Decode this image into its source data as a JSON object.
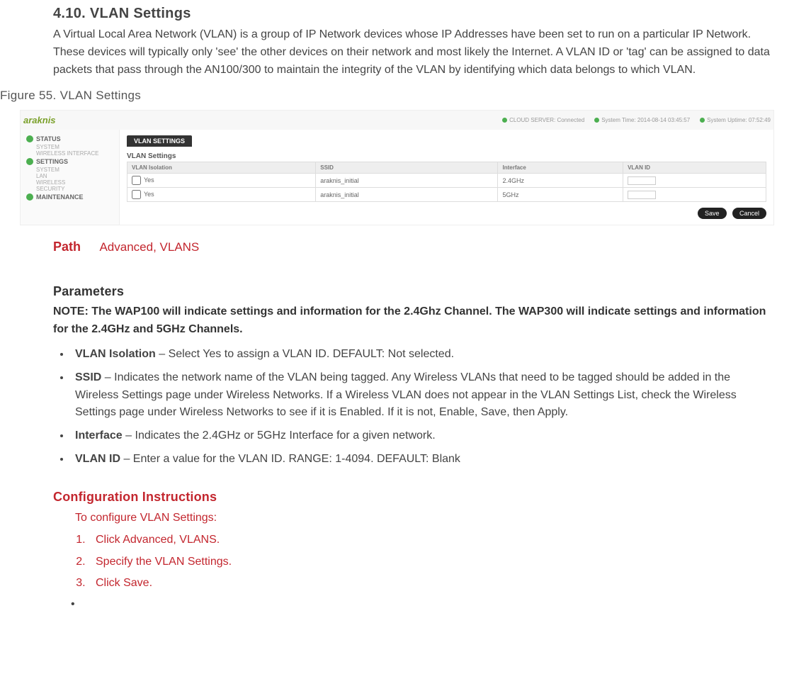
{
  "sectionTitle": "4.10. VLAN Settings",
  "intro": "A Virtual Local Area Network (VLAN) is a group of IP Network devices whose IP Addresses have been set to run on a particular IP Network. These devices will typically only 'see' the other devices on their network and most likely the Internet. A VLAN ID or 'tag' can be assigned to data packets that pass through the AN100/300 to maintain the integrity of the VLAN by identifying which data belongs to which VLAN.",
  "figureCaption": "Figure 55. VLAN Settings",
  "screenshot": {
    "logo": "araknis",
    "cloud": "CLOUD SERVER:  Connected",
    "systemTime": "System Time:  2014-08-14 03:45:57",
    "uptime": "System Uptime:  07:52:49",
    "sidebar": {
      "items": [
        {
          "label": "STATUS",
          "subs": [
            "SYSTEM",
            "WIRELESS INTERFACE"
          ]
        },
        {
          "label": "SETTINGS",
          "subs": [
            "SYSTEM",
            "LAN",
            "WIRELESS",
            "SECURITY"
          ]
        },
        {
          "label": "MAINTENANCE",
          "subs": []
        }
      ]
    },
    "tab": "VLAN SETTINGS",
    "panelTitle": "VLAN Settings",
    "tableHeaders": [
      "VLAN Isolation",
      "SSID",
      "Interface",
      "VLAN ID"
    ],
    "rows": [
      {
        "iso": "Yes",
        "ssid": "araknis_initial",
        "iface": "2.4GHz"
      },
      {
        "iso": "Yes",
        "ssid": "araknis_initial",
        "iface": "5GHz"
      }
    ],
    "save": "Save",
    "cancel": "Cancel"
  },
  "path": {
    "label": "Path",
    "value": "Advanced, VLANS"
  },
  "parametersTitle": "Parameters",
  "note": "NOTE: The WAP100 will indicate settings and information for the 2.4Ghz Channel. The WAP300 will indicate settings and information for the 2.4GHz and 5GHz Channels.",
  "bullets": [
    {
      "term": "VLAN Isolation",
      "desc": " – Select Yes to assign a VLAN ID. DEFAULT: Not selected."
    },
    {
      "term": "SSID",
      "desc": " – Indicates the network name of the VLAN being tagged. Any Wireless VLANs that need to be tagged should be added in the Wireless Settings page under Wireless Networks. If a Wireless VLAN does not appear in the VLAN Settings List, check the Wireless Settings page under Wireless Networks to see if it is Enabled. If it is not, Enable, Save, then Apply."
    },
    {
      "term": "Interface",
      "desc": " – Indicates the 2.4GHz or 5GHz Interface for a given network."
    },
    {
      "term": "VLAN ID",
      "desc": " – Enter a value for the VLAN ID. RANGE: 1-4094. DEFAULT: Blank"
    }
  ],
  "configTitle": "Configuration Instructions",
  "configIntro": "To configure VLAN Settings:",
  "steps": [
    "Click Advanced, VLANS.",
    "Specify the VLAN Settings.",
    "Click Save."
  ],
  "trailingBullet": "•"
}
